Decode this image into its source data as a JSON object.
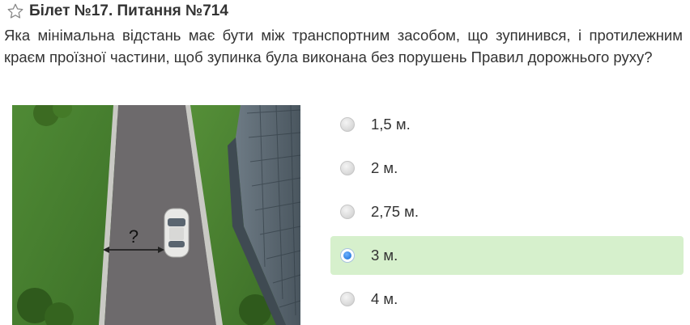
{
  "header": {
    "icon": "star-outline-icon",
    "title": "Білет №17. Питання №714"
  },
  "question": {
    "text": "Яка мінімальна відстань має бути між транспортним засобом, що зупинився, і протилежним краєм проїзної частини, щоб зупинка була виконана без порушень Правил дорожнього руху?"
  },
  "illustration": {
    "distance_label": "?"
  },
  "answers": [
    {
      "label": "1,5 м.",
      "selected": false
    },
    {
      "label": "2 м.",
      "selected": false
    },
    {
      "label": "2,75 м.",
      "selected": false
    },
    {
      "label": "3 м.",
      "selected": true
    },
    {
      "label": "4 м.",
      "selected": false
    }
  ],
  "colors": {
    "selected_bg": "#d6f0cc",
    "radio_checked": "#2d7fe0",
    "text": "#333333"
  }
}
